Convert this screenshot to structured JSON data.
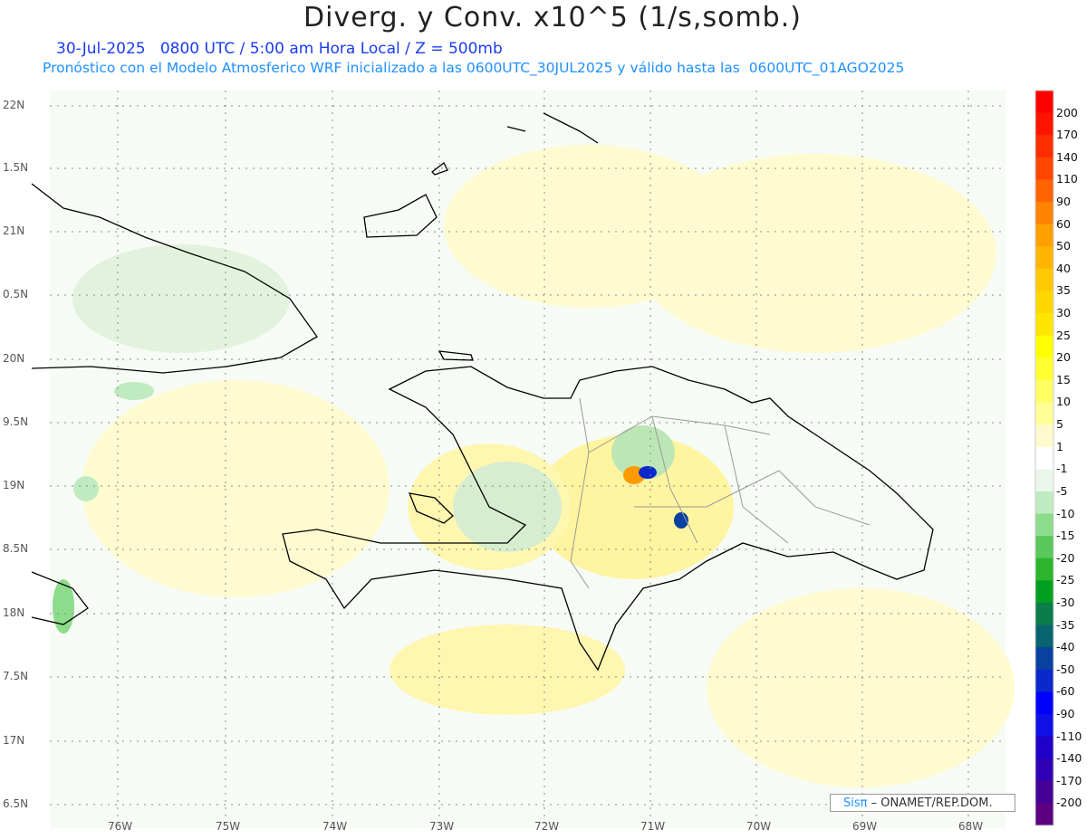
{
  "header": {
    "title": "Diverg. y Conv. x10^5 (1/s,somb.)",
    "subtitle_time": "30-Jul-2025   0800 UTC / 5:00 am Hora Local / Z = 500mb",
    "subtitle_model": "Pronóstico con el Modelo Atmosferico WRF inicializado a las 0600UTC_30JUL2025 y válido hasta las  0600UTC_01AGO2025"
  },
  "axes": {
    "lon_ticks": [
      "76W",
      "75W",
      "74W",
      "73W",
      "72W",
      "71W",
      "70W",
      "69W",
      "68W"
    ],
    "lat_ticks": [
      "22N",
      "1.5N",
      "21N",
      "0.5N",
      "20N",
      "9.5N",
      "19N",
      "8.5N",
      "18N",
      "7.5N",
      "17N",
      "6.5N"
    ]
  },
  "colorbar": {
    "labels": [
      "200",
      "170",
      "140",
      "110",
      "90",
      "60",
      "50",
      "40",
      "35",
      "30",
      "25",
      "20",
      "15",
      "10",
      "5",
      "1",
      "-1",
      "-5",
      "-10",
      "-15",
      "-20",
      "-25",
      "-30",
      "-35",
      "-40",
      "-50",
      "-60",
      "-90",
      "-110",
      "-140",
      "-170",
      "-200"
    ],
    "colors": [
      "#ff0000",
      "#ff1400",
      "#ff2d00",
      "#ff4600",
      "#ff6400",
      "#ff8200",
      "#ffa000",
      "#ffb400",
      "#ffc800",
      "#ffd700",
      "#ffe600",
      "#ffff00",
      "#ffff32",
      "#ffff64",
      "#ffff96",
      "#fffacd",
      "#ffffff",
      "#ebf7eb",
      "#c0ebc0",
      "#8cdc8c",
      "#5ac85a",
      "#2db42d",
      "#00a01e",
      "#0a7d4b",
      "#08646e",
      "#0a41a0",
      "#0a28cc",
      "#0000ff",
      "#1010e6",
      "#2000c8",
      "#3000b4",
      "#460096",
      "#5a0080"
    ]
  },
  "credit": {
    "brand": "Sisπ",
    "text": " – ONAMET/REP.DOM."
  }
}
